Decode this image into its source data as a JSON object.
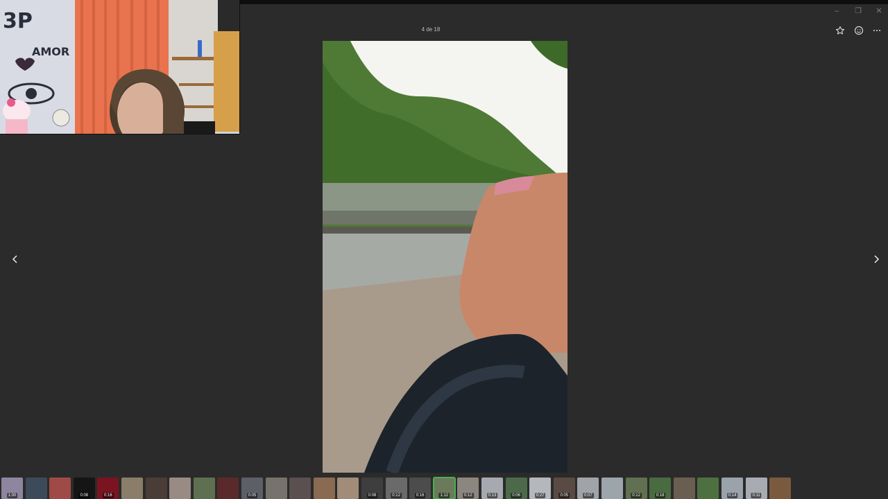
{
  "viewer": {
    "counter": "4 de 18",
    "toolbar": {
      "favorite_icon": "star-icon",
      "react_icon": "smiley-icon",
      "more_icon": "ellipsis-icon"
    },
    "window_controls": [
      "minimize-icon",
      "restore-icon",
      "close-icon"
    ],
    "nav": {
      "prev_icon": "chevron-left-icon",
      "next_icon": "chevron-right-icon"
    }
  },
  "webcam_overlay": {
    "wall_graffiti": [
      "3P",
      "AMOR"
    ]
  },
  "filmstrip": {
    "selected_index": 18,
    "thumbs": [
      {
        "color": "#8e86a0",
        "dur": "1:00"
      },
      {
        "color": "#3d4a5a",
        "dur": ""
      },
      {
        "color": "#a04a48",
        "dur": ""
      },
      {
        "color": "#151515",
        "dur": "0:08"
      },
      {
        "color": "#7a1420",
        "dur": "0:16"
      },
      {
        "color": "#8a7d6a",
        "dur": ""
      },
      {
        "color": "#4a3c36",
        "dur": ""
      },
      {
        "color": "#9a8a84",
        "dur": ""
      },
      {
        "color": "#5e7050",
        "dur": ""
      },
      {
        "color": "#5a2a2a",
        "dur": ""
      },
      {
        "color": "#5c5f66",
        "dur": "0:05"
      },
      {
        "color": "#78726c",
        "dur": ""
      },
      {
        "color": "#5a5050",
        "dur": ""
      },
      {
        "color": "#8a6a50",
        "dur": ""
      },
      {
        "color": "#a08c78",
        "dur": ""
      },
      {
        "color": "#3e3e3e",
        "dur": "0:08"
      },
      {
        "color": "#6a6a6a",
        "dur": "0:12"
      },
      {
        "color": "#4c4c4c",
        "dur": "0:16"
      },
      {
        "color": "#6a7a5a",
        "dur": "1:12"
      },
      {
        "color": "#8c8680",
        "dur": "0:12"
      },
      {
        "color": "#a6aab0",
        "dur": "0:13"
      },
      {
        "color": "#4c6a4a",
        "dur": "0:06"
      },
      {
        "color": "#b4b8bc",
        "dur": "0:27"
      },
      {
        "color": "#5a4a44",
        "dur": "0:05"
      },
      {
        "color": "#a0a4a8",
        "dur": "0:07"
      },
      {
        "color": "#9ca4ac",
        "dur": ""
      },
      {
        "color": "#607050",
        "dur": "0:12"
      },
      {
        "color": "#4a6a40",
        "dur": "0:18"
      },
      {
        "color": "#6a5e50",
        "dur": ""
      },
      {
        "color": "#4e7040",
        "dur": ""
      },
      {
        "color": "#9aa2aa",
        "dur": "0:14"
      },
      {
        "color": "#a8acb2",
        "dur": "0:11"
      },
      {
        "color": "#7a5a3e",
        "dur": ""
      }
    ]
  }
}
